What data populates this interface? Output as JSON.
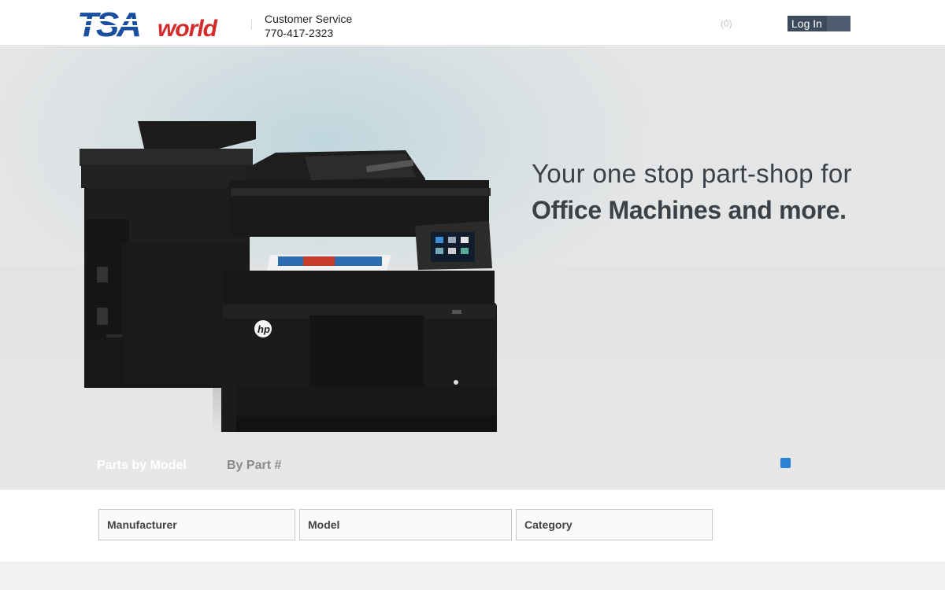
{
  "brand": {
    "logo_text": "TSAworld",
    "logo_primary": "TSA",
    "logo_secondary": "world",
    "primary_color": "#1a4fa0",
    "secondary_color": "#d42a2a"
  },
  "header": {
    "customer_service_label": "Customer Service",
    "phone": "770-417-2323",
    "cart_count": "(0)",
    "login_label": "Log In"
  },
  "hero": {
    "tagline_line1": "Your one stop part-shop for",
    "tagline_line2": "Office Machines and more.",
    "image": "hp-multifunction-printer",
    "printer_brand": "hp"
  },
  "tabs": [
    {
      "label": "Parts by Model",
      "active": true
    },
    {
      "label": "By Part #",
      "active": false
    }
  ],
  "slider": {
    "active_dot_color": "#2a82d4"
  },
  "search": {
    "manufacturer": "Manufacturer",
    "model": "Model",
    "category": "Category"
  }
}
